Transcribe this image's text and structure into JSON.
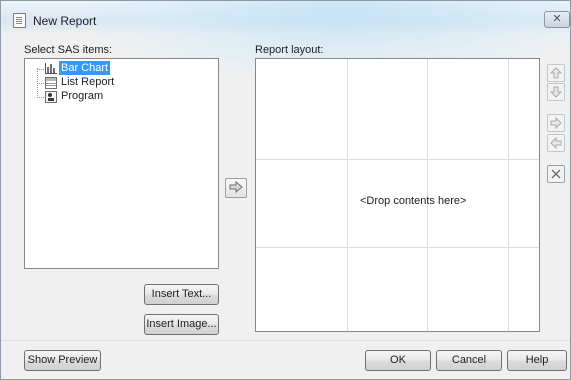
{
  "window": {
    "title": "New Report",
    "close_glyph": "✕"
  },
  "sas_items": {
    "label": "Select SAS items:",
    "items": [
      {
        "label": "Bar Chart",
        "icon": "bar-chart-icon",
        "selected": true
      },
      {
        "label": "List Report",
        "icon": "list-report-icon",
        "selected": false
      },
      {
        "label": "Program",
        "icon": "program-icon",
        "selected": false
      }
    ]
  },
  "buttons": {
    "insert_text": "Insert Text...",
    "insert_image": "Insert Image...",
    "show_preview": "Show Preview",
    "ok": "OK",
    "cancel": "Cancel",
    "help": "Help"
  },
  "report_layout": {
    "label": "Report layout:",
    "placeholder": "<Drop contents here>"
  },
  "icons": {
    "add_to_layout": "right-arrow-icon",
    "move_up": "up-arrow-icon",
    "move_down": "down-arrow-icon",
    "move_right": "right-arrow-icon",
    "move_left": "left-arrow-icon",
    "delete": "delete-x-icon"
  }
}
